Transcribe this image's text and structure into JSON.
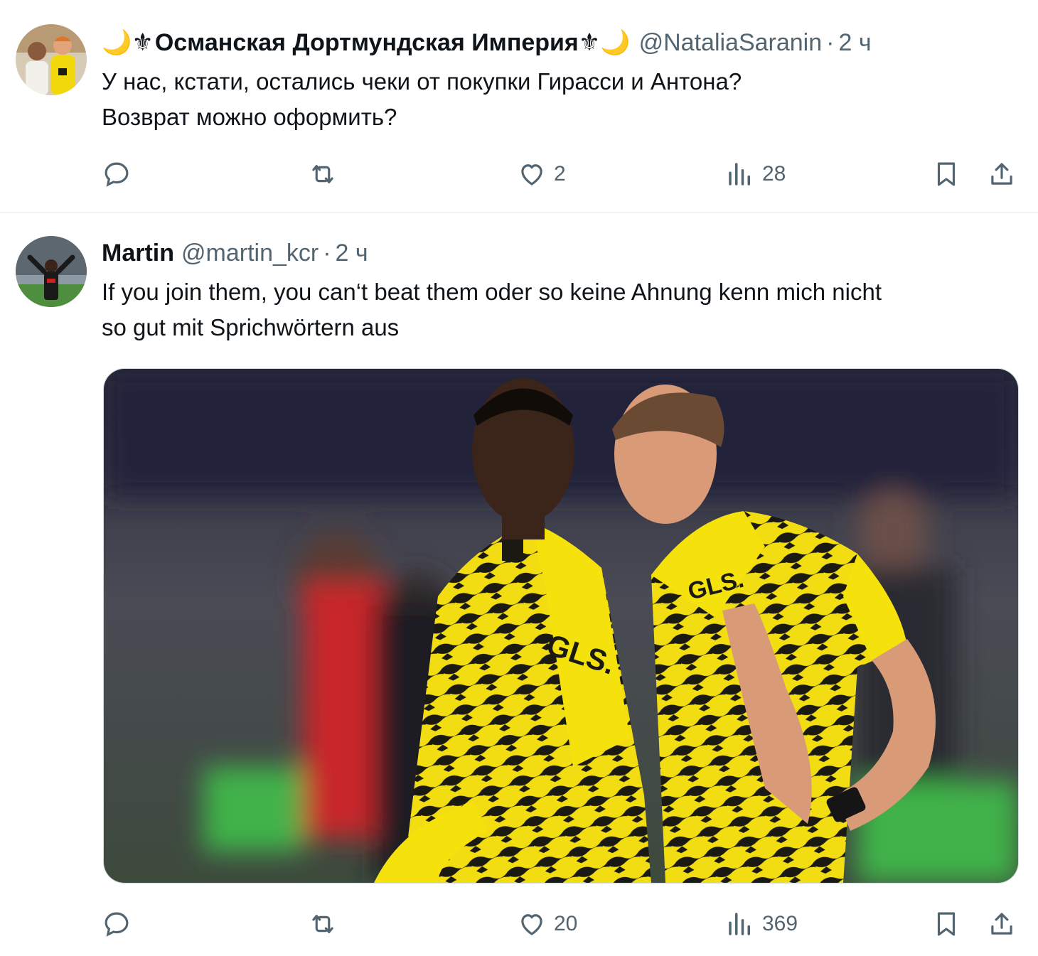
{
  "tweets": [
    {
      "display_name": "Османская Дортмундская Империя",
      "emoji_left": "🌙⚜",
      "emoji_right": "⚜🌙",
      "handle": "@NataliaSaranin",
      "separator": "·",
      "time": "2 ч",
      "text_lines": [
        "У нас, кстати, остались чеки от покупки Гирасси и Антона?",
        "Возврат можно оформить?"
      ],
      "stats": {
        "replies": "",
        "retweets": "",
        "likes": "2",
        "views": "28"
      }
    },
    {
      "display_name": "Martin",
      "handle": "@martin_kcr",
      "separator": "·",
      "time": "2 ч",
      "text_lines": [
        "If you join them, you can‘t beat them oder so keine Ahnung kenn mich nicht",
        "so gut mit Sprichwörtern aus"
      ],
      "media_logo": "GLS.",
      "stats": {
        "replies": "",
        "retweets": "",
        "likes": "20",
        "views": "369"
      }
    }
  ],
  "icons": [
    "reply-icon",
    "retweet-icon",
    "like-icon",
    "views-icon",
    "bookmark-icon",
    "share-icon"
  ],
  "colors": {
    "text": "#0f1419",
    "secondary": "#536471",
    "divider": "#eff3f4",
    "jersey_yellow": "#f5e20c"
  }
}
